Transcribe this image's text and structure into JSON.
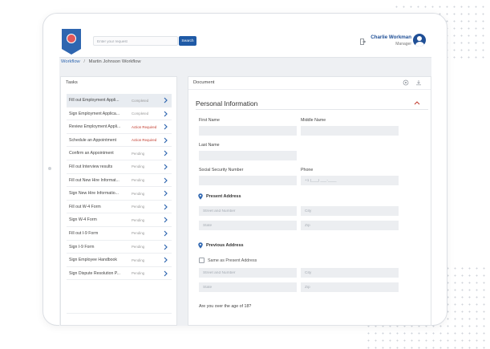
{
  "header": {
    "search_placeholder": "Enter your request",
    "search_button": "Search",
    "user_name": "Charlie Workman",
    "user_role": "Manager"
  },
  "breadcrumb": {
    "root": "Workflow",
    "separator": "/",
    "current": "Martin Johnson Workflow"
  },
  "tasks": {
    "title": "Tasks",
    "items": [
      {
        "name": "Fill out Employment Appli...",
        "status": "Completed"
      },
      {
        "name": "Sign Employment Applica...",
        "status": "Completed"
      },
      {
        "name": "Review Employment Appli...",
        "status": "Action Required"
      },
      {
        "name": "Schedule an Appointment",
        "status": "Action Required"
      },
      {
        "name": "Confirm an Appointment",
        "status": "Pending"
      },
      {
        "name": "Fill out Interview results",
        "status": "Pending"
      },
      {
        "name": "Fill out New Hire Informat...",
        "status": "Pending"
      },
      {
        "name": "Sign New Hire Informatio...",
        "status": "Pending"
      },
      {
        "name": "Fill out W-4 Form",
        "status": "Pending"
      },
      {
        "name": "Sign W-4 Form",
        "status": "Pending"
      },
      {
        "name": "Fill out I-9 Form",
        "status": "Pending"
      },
      {
        "name": "Sign I-9 Form",
        "status": "Pending"
      },
      {
        "name": "Sign Employee Handbook",
        "status": "Pending"
      },
      {
        "name": "Sign Dispute Resolution P...",
        "status": "Pending"
      }
    ]
  },
  "document": {
    "title": "Document",
    "section_title": "Personal Information",
    "first_name_label": "First Name",
    "middle_name_label": "Middle Name",
    "last_name_label": "Last Name",
    "ssn_label": "Social Security Number",
    "phone_label": "Phone",
    "phone_placeholder": "+1 (___) ___-____",
    "present_address_title": "Present Address",
    "previous_address_title": "Previous Address",
    "street_placeholder": "Street and Number",
    "city_placeholder": "City",
    "state_placeholder": "State",
    "zip_placeholder": "Zip",
    "same_as_present_label": "Same as Present Address",
    "age_question": "Are you over the age of 18?"
  },
  "colors": {
    "brand_blue": "#1f5aa6",
    "link_blue": "#2f66b0",
    "action_required": "#c0392b",
    "chevron": "#2f66b0",
    "collapse_red": "#c0392b"
  },
  "icons": {
    "logo": "logo-icon",
    "logout": "logout-icon",
    "avatar": "user-avatar-icon",
    "chevron": "chevron-right-icon",
    "settings": "gear-icon",
    "download": "download-icon",
    "collapse": "chevron-up-icon",
    "location": "location-pin-icon"
  }
}
